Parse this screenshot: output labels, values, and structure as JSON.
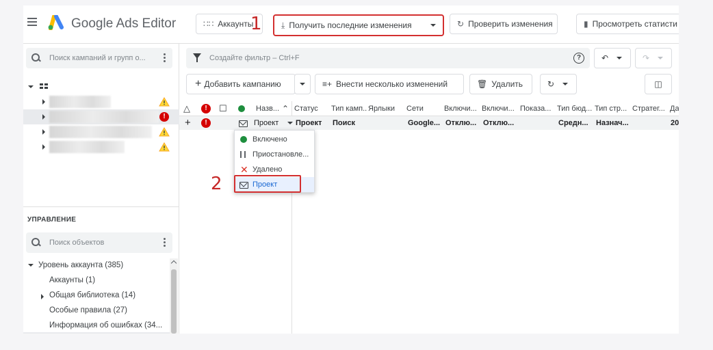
{
  "app": {
    "name": "Google Ads Editor",
    "logo_colors": [
      "#4285F4",
      "#FBBC04",
      "#34A853"
    ]
  },
  "toolbar": {
    "accounts_label": "Аккаунты",
    "get_changes_label": "Получить последние изменения",
    "check_changes_label": "Проверить изменения",
    "view_stats_label": "Просмотреть статисти"
  },
  "annotations": {
    "marker1": "1",
    "marker2": "2",
    "highlight_color": "#d32f2f"
  },
  "left": {
    "search_placeholder": "Поиск кампаний и групп о...",
    "management_title": "УПРАВЛЕНИЕ",
    "objects_search_placeholder": "Поиск объектов",
    "account_tree": [
      {
        "label": "Уровень аккаунта (385)",
        "expanded": true
      },
      {
        "label": "Аккаунты (1)"
      },
      {
        "label": "Общая библиотека (14)",
        "expandable": true
      },
      {
        "label": "Особые правила (27)"
      },
      {
        "label": "Информация об ошибках (34..."
      }
    ]
  },
  "main": {
    "filter_placeholder": "Создайте фильтр – Ctrl+F",
    "help_label": "?",
    "add_campaign_label": "Добавить кампанию",
    "multi_changes_label": "Внести несколько изменений",
    "delete_label": "Удалить",
    "columns": [
      "Назв...",
      "Статус",
      "Тип камп...",
      "Ярлыки",
      "Сети",
      "Включи...",
      "Включи...",
      "Показа...",
      "Тип бюд...",
      "Тип стр...",
      "Стратег...",
      "Да"
    ],
    "row": {
      "name": "Проект",
      "status": "Проект",
      "type": "Поиск",
      "labels": "",
      "networks": "Google...",
      "incl1": "Отклю...",
      "incl2": "Отклю...",
      "shows": "",
      "budget": "Средн...",
      "strategy_type": "Назнач...",
      "strategy": "",
      "date": "20"
    },
    "status_menu": [
      {
        "label": "Включено",
        "icon": "green-dot-icon",
        "color": "#1e8e3e"
      },
      {
        "label": "Приостановле...",
        "icon": "pause-icon"
      },
      {
        "label": "Удалено",
        "icon": "x-icon",
        "color": "#d93025"
      },
      {
        "label": "Проект",
        "icon": "envelope-icon",
        "selected": true
      }
    ]
  }
}
